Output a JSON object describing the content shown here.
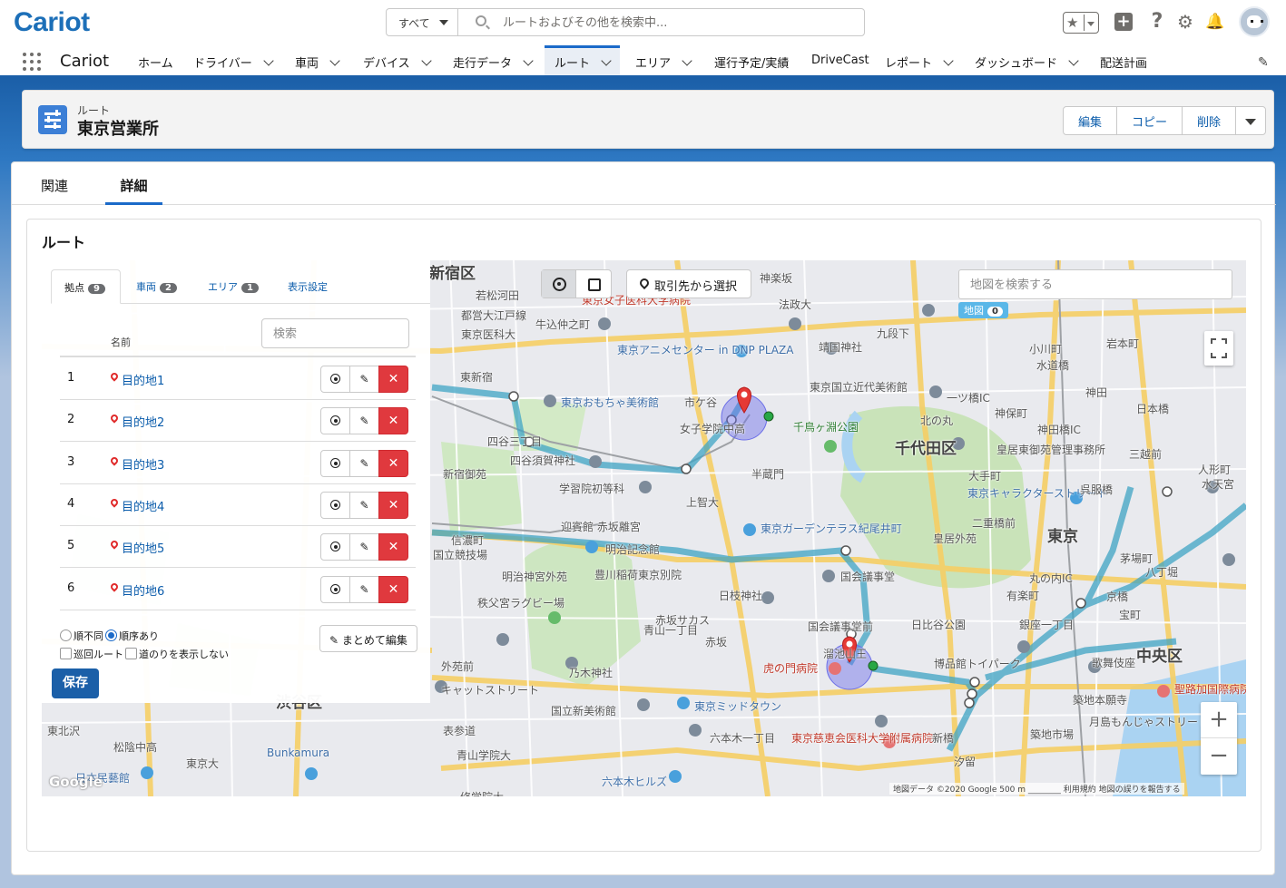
{
  "header": {
    "logo": "Cariot",
    "search_scope": "すべて",
    "search_placeholder": "ルートおよびその他を検索中..."
  },
  "nav": {
    "app_name": "Cariot",
    "items": [
      {
        "label": "ホーム",
        "dropdown": false
      },
      {
        "label": "ドライバー",
        "dropdown": true
      },
      {
        "label": "車両",
        "dropdown": true
      },
      {
        "label": "デバイス",
        "dropdown": true
      },
      {
        "label": "走行データ",
        "dropdown": true
      },
      {
        "label": "ルート",
        "dropdown": true,
        "active": true
      },
      {
        "label": "エリア",
        "dropdown": true
      },
      {
        "label": "運行予定/実績",
        "dropdown": false
      },
      {
        "label": "DriveCast",
        "dropdown": false
      },
      {
        "label": "レポート",
        "dropdown": true
      },
      {
        "label": "ダッシュボード",
        "dropdown": true
      },
      {
        "label": "配送計画",
        "dropdown": false
      }
    ]
  },
  "record": {
    "object_label": "ルート",
    "title": "東京営業所",
    "actions": [
      "編集",
      "コピー",
      "削除"
    ]
  },
  "tabs": [
    "関連",
    "詳細"
  ],
  "section_title": "ルート",
  "panel": {
    "tabs": [
      {
        "label": "拠点",
        "count": "9"
      },
      {
        "label": "車両",
        "count": "2"
      },
      {
        "label": "エリア",
        "count": "1"
      },
      {
        "label": "表示設定",
        "count": ""
      }
    ],
    "search_placeholder": "検索",
    "column_name": "名前",
    "rows": [
      {
        "num": "1",
        "name": "目的地1"
      },
      {
        "num": "2",
        "name": "目的地2"
      },
      {
        "num": "3",
        "name": "目的地3"
      },
      {
        "num": "4",
        "name": "目的地4"
      },
      {
        "num": "5",
        "name": "目的地5"
      },
      {
        "num": "6",
        "name": "目的地6"
      }
    ],
    "order_unordered": "順不同",
    "order_ordered": "順序あり",
    "loop_route": "巡回ルート",
    "hide_path": "道のりを表示しない",
    "bulk_edit": "まとめて編集",
    "save": "保存"
  },
  "map": {
    "select_from_account": "取引先から選択",
    "search_placeholder": "地図を検索する",
    "badge_label": "地図",
    "badge_count": "0",
    "attribution": "地図データ ©2020 Google   500 m ________   利用規約   地図の誤りを報告する",
    "google": "Google",
    "labels": [
      {
        "t": "新宿区",
        "c": "big"
      },
      {
        "t": "若松河田",
        "c": ""
      },
      {
        "t": "都営大江戸線",
        "c": ""
      },
      {
        "t": "東京医科大",
        "c": ""
      },
      {
        "t": "牛込仲之町",
        "c": ""
      },
      {
        "t": "東京女子医科大学病院",
        "c": "red"
      },
      {
        "t": "法政大",
        "c": ""
      },
      {
        "t": "東京アニメセンター in DNP PLAZA",
        "c": "blue"
      },
      {
        "t": "靖国神社",
        "c": ""
      },
      {
        "t": "東京国立近代美術館",
        "c": ""
      },
      {
        "t": "東京おもちゃ美術館",
        "c": "blue"
      },
      {
        "t": "市ケ谷",
        "c": ""
      },
      {
        "t": "女子学院中高",
        "c": ""
      },
      {
        "t": "千鳥ヶ淵公園",
        "c": "grn"
      },
      {
        "t": "千代田区",
        "c": "big"
      },
      {
        "t": "皇居東御苑管理事務所",
        "c": ""
      },
      {
        "t": "四谷三丁目",
        "c": ""
      },
      {
        "t": "四谷須賀神社",
        "c": ""
      },
      {
        "t": "新宿御苑",
        "c": ""
      },
      {
        "t": "半蔵門",
        "c": ""
      },
      {
        "t": "学習院初等科",
        "c": ""
      },
      {
        "t": "上智大",
        "c": ""
      },
      {
        "t": "迎賓館 赤坂離宮",
        "c": ""
      },
      {
        "t": "東京ガーデンテラス紀尾井町",
        "c": "blue"
      },
      {
        "t": "皇居外苑",
        "c": ""
      },
      {
        "t": "東京",
        "c": "big"
      },
      {
        "t": "明治記念館",
        "c": ""
      },
      {
        "t": "明治神宮外苑",
        "c": ""
      },
      {
        "t": "豊川稲荷東京別院",
        "c": ""
      },
      {
        "t": "国会議事堂",
        "c": ""
      },
      {
        "t": "日枝神社",
        "c": ""
      },
      {
        "t": "秩父宮ラグビー場",
        "c": ""
      },
      {
        "t": "赤坂サカス",
        "c": ""
      },
      {
        "t": "日比谷公園",
        "c": ""
      },
      {
        "t": "有楽町",
        "c": ""
      },
      {
        "t": "銀座一丁目",
        "c": ""
      },
      {
        "t": "国会議事堂前",
        "c": ""
      },
      {
        "t": "虎の門病院",
        "c": "red"
      },
      {
        "t": "博品館トイパーク",
        "c": ""
      },
      {
        "t": "中央区",
        "c": "big"
      },
      {
        "t": "歌舞伎座",
        "c": ""
      },
      {
        "t": "築地本願寺",
        "c": ""
      },
      {
        "t": "聖路加国際病院",
        "c": "red"
      },
      {
        "t": "東京ミッドタウン",
        "c": "blue"
      },
      {
        "t": "国立新美術館",
        "c": ""
      },
      {
        "t": "六本木一丁目",
        "c": ""
      },
      {
        "t": "東京慈恵会医科大学附属病院",
        "c": "red"
      },
      {
        "t": "新橋",
        "c": ""
      },
      {
        "t": "築地市場",
        "c": ""
      },
      {
        "t": "月島もんじゃストリート",
        "c": ""
      },
      {
        "t": "キャットストリート",
        "c": ""
      },
      {
        "t": "表参道",
        "c": ""
      },
      {
        "t": "青山学院大",
        "c": ""
      },
      {
        "t": "六本木ヒルズ",
        "c": "blue"
      },
      {
        "t": "Bunkamura",
        "c": "blue"
      },
      {
        "t": "東京大",
        "c": ""
      },
      {
        "t": "松陰中高",
        "c": ""
      },
      {
        "t": "日本民藝館",
        "c": "blue"
      },
      {
        "t": "東北沢",
        "c": ""
      },
      {
        "t": "修学院大",
        "c": ""
      },
      {
        "t": "九段下",
        "c": ""
      },
      {
        "t": "神保町",
        "c": ""
      },
      {
        "t": "小川町",
        "c": ""
      },
      {
        "t": "岩本町",
        "c": ""
      },
      {
        "t": "神田",
        "c": ""
      },
      {
        "t": "三越前",
        "c": ""
      },
      {
        "t": "日本橋",
        "c": ""
      },
      {
        "t": "人形町",
        "c": ""
      },
      {
        "t": "水天宮",
        "c": ""
      },
      {
        "t": "茅場町",
        "c": ""
      },
      {
        "t": "八丁堀",
        "c": ""
      },
      {
        "t": "京橋",
        "c": ""
      },
      {
        "t": "宝町",
        "c": ""
      },
      {
        "t": "二重橋前",
        "c": ""
      },
      {
        "t": "大手町",
        "c": ""
      },
      {
        "t": "東京キャラクターストリート",
        "c": "blue"
      },
      {
        "t": "乃木神社",
        "c": ""
      },
      {
        "t": "青山一丁目",
        "c": ""
      },
      {
        "t": "赤坂",
        "c": ""
      },
      {
        "t": "溜池山王",
        "c": ""
      },
      {
        "t": "汐留",
        "c": ""
      },
      {
        "t": "国立競技場",
        "c": ""
      },
      {
        "t": "信濃町",
        "c": ""
      },
      {
        "t": "外苑前",
        "c": ""
      },
      {
        "t": "神楽坂",
        "c": ""
      },
      {
        "t": "水道橋",
        "c": ""
      },
      {
        "t": "一ツ橋IC",
        "c": ""
      },
      {
        "t": "神田橋IC",
        "c": ""
      },
      {
        "t": "呉服橋",
        "c": ""
      },
      {
        "t": "丸の内IC",
        "c": ""
      },
      {
        "t": "北の丸",
        "c": ""
      },
      {
        "t": "東新宿",
        "c": ""
      },
      {
        "t": "渋谷区",
        "c": "big"
      }
    ]
  }
}
